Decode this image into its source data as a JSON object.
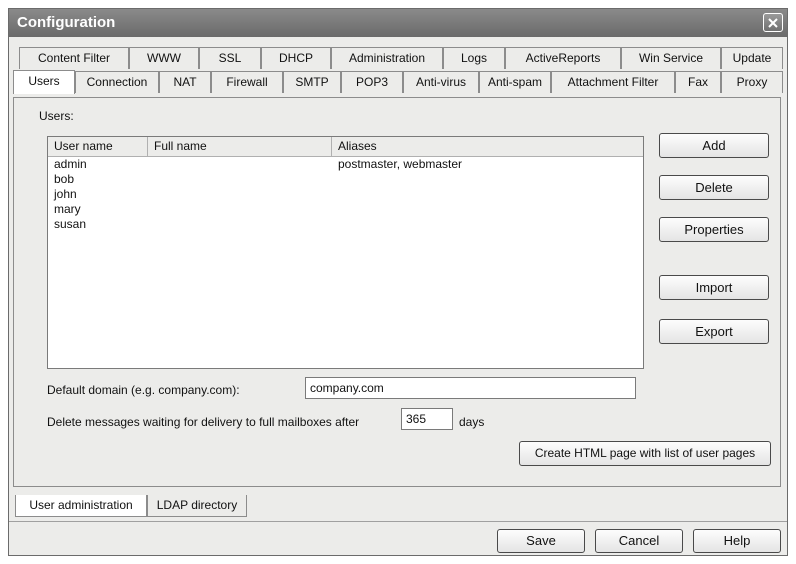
{
  "window": {
    "title": "Configuration"
  },
  "tabs_row1": [
    "Content Filter",
    "WWW",
    "SSL",
    "DHCP",
    "Administration",
    "Logs",
    "ActiveReports",
    "Win Service",
    "Update"
  ],
  "tabs_row2": [
    "Users",
    "Connection",
    "NAT",
    "Firewall",
    "SMTP",
    "POP3",
    "Anti-virus",
    "Anti-spam",
    "Attachment Filter",
    "Fax",
    "Proxy"
  ],
  "active_tab": "Users",
  "users_panel": {
    "label": "Users:",
    "columns": [
      "User name",
      "Full name",
      "Aliases"
    ],
    "rows": [
      {
        "user": "admin",
        "full": "",
        "aliases": "postmaster, webmaster"
      },
      {
        "user": "bob",
        "full": "",
        "aliases": ""
      },
      {
        "user": "john",
        "full": "",
        "aliases": ""
      },
      {
        "user": "mary",
        "full": "",
        "aliases": ""
      },
      {
        "user": "susan",
        "full": "",
        "aliases": ""
      }
    ]
  },
  "side_buttons": {
    "add": "Add",
    "delete": "Delete",
    "properties": "Properties",
    "import": "Import",
    "export": "Export"
  },
  "default_domain": {
    "label": "Default domain (e.g. company.com):",
    "value": "company.com"
  },
  "delete_messages": {
    "label": "Delete messages waiting for delivery to full mailboxes after",
    "value": "365",
    "unit": "days"
  },
  "create_html_button": "Create HTML page with list of user pages",
  "bottom_tabs": [
    "User administration",
    "LDAP directory"
  ],
  "footer": {
    "save": "Save",
    "cancel": "Cancel",
    "help": "Help"
  }
}
